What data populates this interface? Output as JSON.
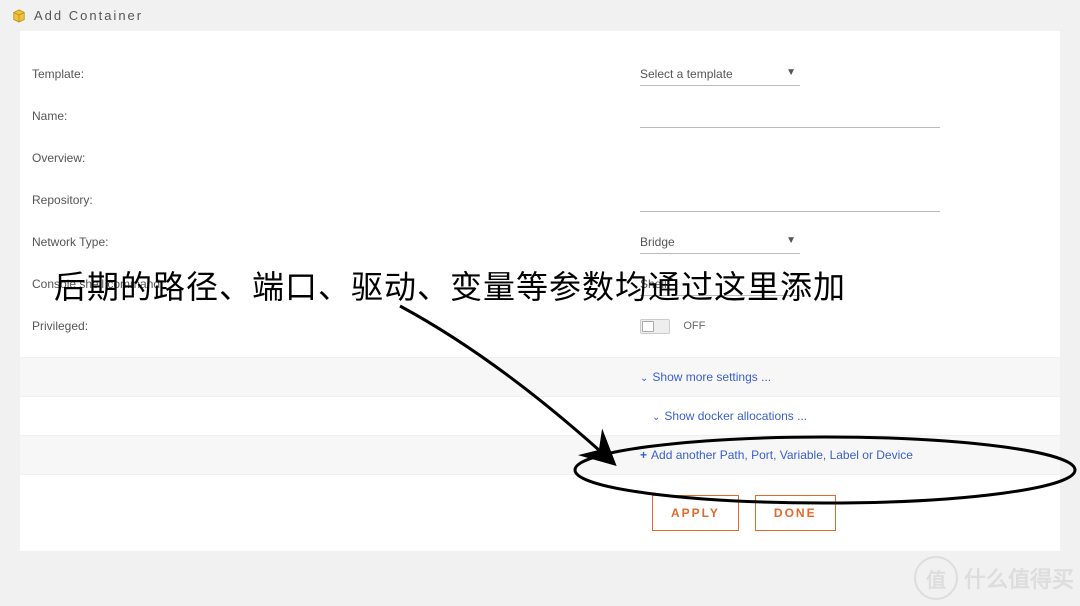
{
  "header": {
    "title": "Add Container"
  },
  "form": {
    "template_label": "Template:",
    "template_value": "Select a template",
    "name_label": "Name:",
    "name_value": "",
    "overview_label": "Overview:",
    "repository_label": "Repository:",
    "repository_value": "",
    "network_label": "Network Type:",
    "network_value": "Bridge",
    "console_label": "Console shell command:",
    "console_value": "Shell",
    "privileged_label": "Privileged:",
    "privileged_value": "OFF"
  },
  "links": {
    "show_more": "Show more settings ...",
    "show_docker": "Show docker allocations ...",
    "add_another": "Add another Path, Port, Variable, Label or Device"
  },
  "buttons": {
    "apply": "APPLY",
    "done": "DONE"
  },
  "annotation": {
    "text": "后期的路径、端口、驱动、变量等参数均通过这里添加"
  },
  "watermark": {
    "symbol": "值",
    "text": "什么值得买"
  }
}
